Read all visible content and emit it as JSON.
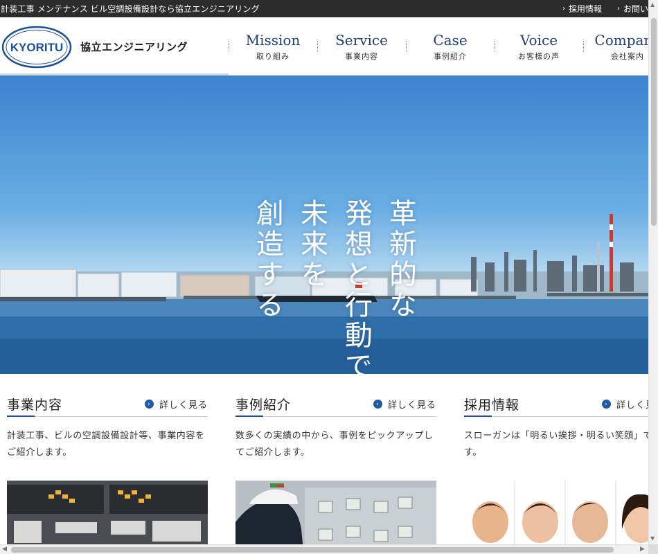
{
  "topbar": {
    "tagline": "計装工事 メンテナンス ビル空調設備設計なら協立エンジニアリング",
    "links": [
      "採用情報",
      "お問い"
    ]
  },
  "header": {
    "logo_text": "KYORITU",
    "company_name": "協立エンジニアリング"
  },
  "nav": [
    {
      "en": "Mission",
      "jp": "取り組み"
    },
    {
      "en": "Service",
      "jp": "事業内容"
    },
    {
      "en": "Case",
      "jp": "事例紹介"
    },
    {
      "en": "Voice",
      "jp": "お客様の声"
    },
    {
      "en": "Company",
      "jp": "会社案内"
    }
  ],
  "hero": {
    "slogan": [
      "革新的な",
      "発想と行動で",
      "未来を",
      "創造する"
    ]
  },
  "cards": [
    {
      "title": "事業内容",
      "more": "詳しく見る",
      "desc": "計装工事、ビルの空調設備設計等、事業内容をご紹介します。"
    },
    {
      "title": "事例紹介",
      "more": "詳しく見る",
      "desc": "数多くの実績の中から、事例をピックアップしてご紹介します。"
    },
    {
      "title": "採用情報",
      "more": "詳しく見る",
      "desc": "スローガンは「明るい挨拶・明るい笑顔」です。"
    }
  ],
  "colors": {
    "topbar_bg": "#2c2c2c",
    "nav_text": "#1f3f78",
    "accent": "#1f5aa6",
    "logo_blue": "#1a4f9c"
  }
}
